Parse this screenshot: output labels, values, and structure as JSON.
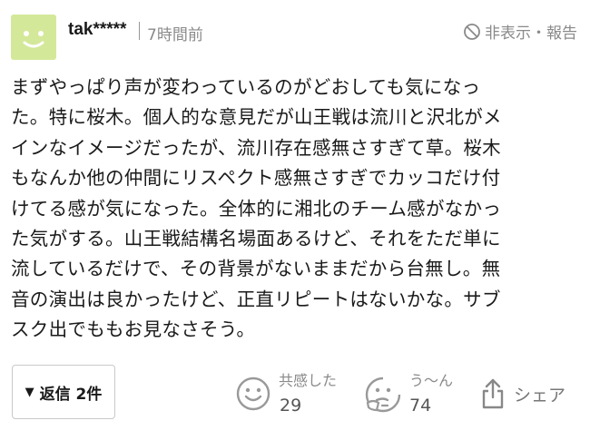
{
  "comment": {
    "user": {
      "name": "tak*****",
      "avatar_color": "#d4e89a"
    },
    "time": "7時間前",
    "hide_report_label": "非表示・報告",
    "lines": [
      "まずやっぱり声が変わっているのがどおしても気になっ",
      "た。特に桜木。個人的な意見だが山王戦は流川と沢北がメ",
      "インなイメージだったが、流川存在感無さすぎて草。桜木",
      "もなんか他の仲間にリスペクト感無さすぎでカッコだけ付",
      "けてる感が気になった。全体的に湘北のチーム感がなかっ",
      "た気がする。山王戦結構名場面あるけど、それをただ単に",
      "流しているだけで、その背景がないままだから台無し。無",
      "音の演出は良かったけど、正直リピートはないかな。サブ",
      "スク出でももお見なさそう。"
    ]
  },
  "actions": {
    "reply_label": "返信 2件",
    "empathy": {
      "label": "共感した",
      "count": "29"
    },
    "hmm": {
      "label": "う〜ん",
      "count": "74"
    },
    "share_label": "シェア"
  },
  "colors": {
    "muted": "#8a8a8a",
    "text": "#1a1a1a",
    "border": "#c9c9c9"
  }
}
